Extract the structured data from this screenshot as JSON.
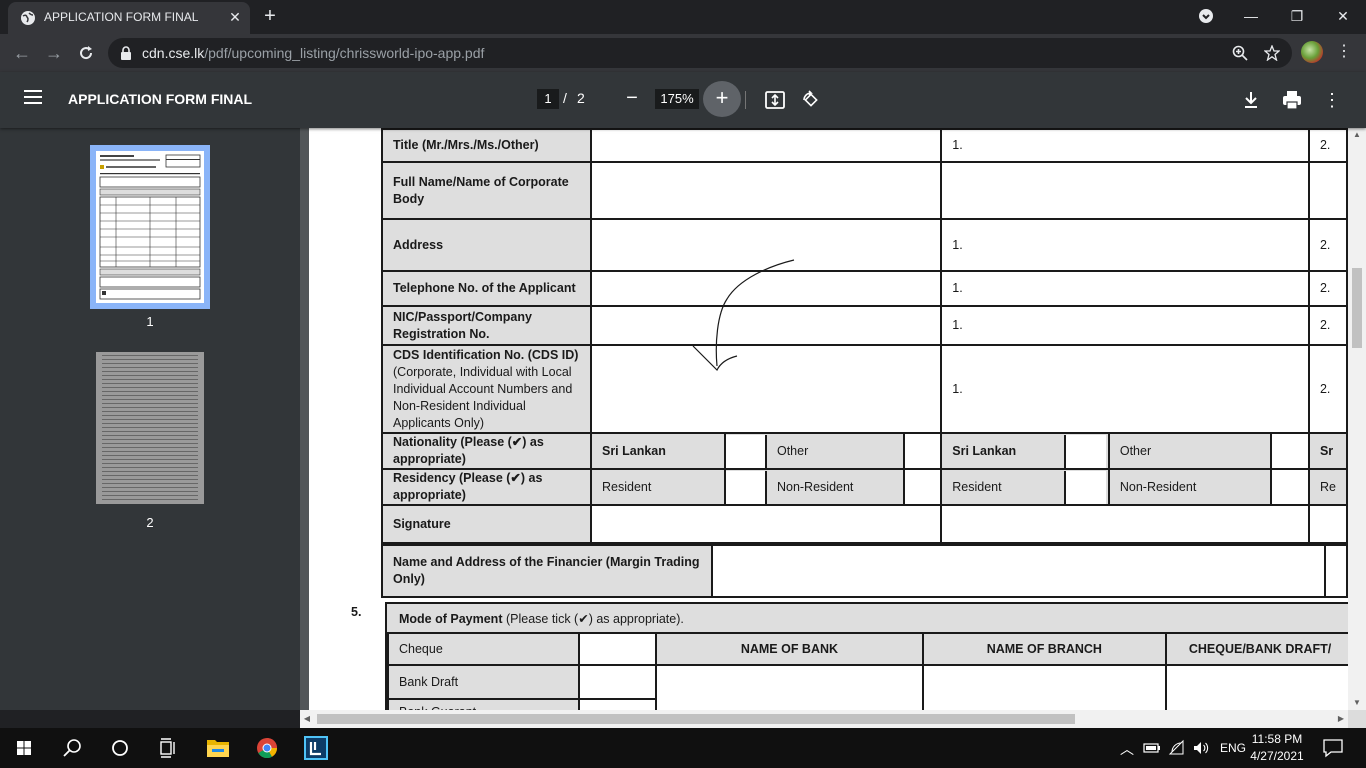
{
  "browser": {
    "tab_title": "APPLICATION FORM FINAL",
    "url_host": "cdn.cse.lk",
    "url_path": "/pdf/upcoming_listing/chrissworld-ipo-app.pdf"
  },
  "pdf_toolbar": {
    "title": "APPLICATION FORM FINAL",
    "page_current": "1",
    "page_separator": "/",
    "page_total": "2",
    "zoom": "175%"
  },
  "sidebar": {
    "thumbnails": [
      {
        "label": "1",
        "selected": true
      },
      {
        "label": "2",
        "selected": false
      }
    ]
  },
  "form": {
    "rows": {
      "title": {
        "label": "Title (Mr./Mrs./Ms./Other)",
        "col2_num": "1.",
        "col3_num": "2."
      },
      "full_name": {
        "label": "Full Name/Name of Corporate Body"
      },
      "address": {
        "label": "Address",
        "col2_num": "1.",
        "col3_num": "2."
      },
      "telephone": {
        "label": "Telephone No. of the Applicant",
        "col2_num": "1.",
        "col3_num": "2."
      },
      "nic": {
        "label": "NIC/Passport/Company Registration No.",
        "col2_num": "1.",
        "col3_num": "2."
      },
      "cds": {
        "label": "CDS Identification No. (CDS ID)",
        "sublabel": "(Corporate, Individual with Local Individual Account Numbers and Non-Resident Individual Applicants Only)",
        "col2_num": "1.",
        "col3_num": "2."
      },
      "nationality": {
        "label": "Nationality (Please (✔) as appropriate)",
        "opt1": "Sri Lankan",
        "opt2": "Other",
        "opt3": "Sri Lankan",
        "opt4": "Other",
        "opt5": "Sr"
      },
      "residency": {
        "label": "Residency (Please (✔) as appropriate)",
        "opt1": "Resident",
        "opt2": "Non-Resident",
        "opt3": "Resident",
        "opt4": "Non-Resident",
        "opt5": "Re"
      },
      "signature": {
        "label": "Signature"
      }
    },
    "financier": {
      "label": "Name and Address of the Financier (Margin Trading Only)"
    },
    "payment": {
      "section_number": "5.",
      "heading_bold": "Mode of Payment",
      "heading_rest": " (Please tick (✔) as appropriate).",
      "headers": [
        "NAME OF BANK",
        "NAME OF BRANCH",
        "CHEQUE/BANK DRAFT/"
      ],
      "rows": [
        "Cheque",
        "Bank Draft",
        "Bank Guarant"
      ]
    }
  },
  "taskbar": {
    "language": "ENG",
    "time": "11:58 PM",
    "date": "4/27/2021"
  }
}
